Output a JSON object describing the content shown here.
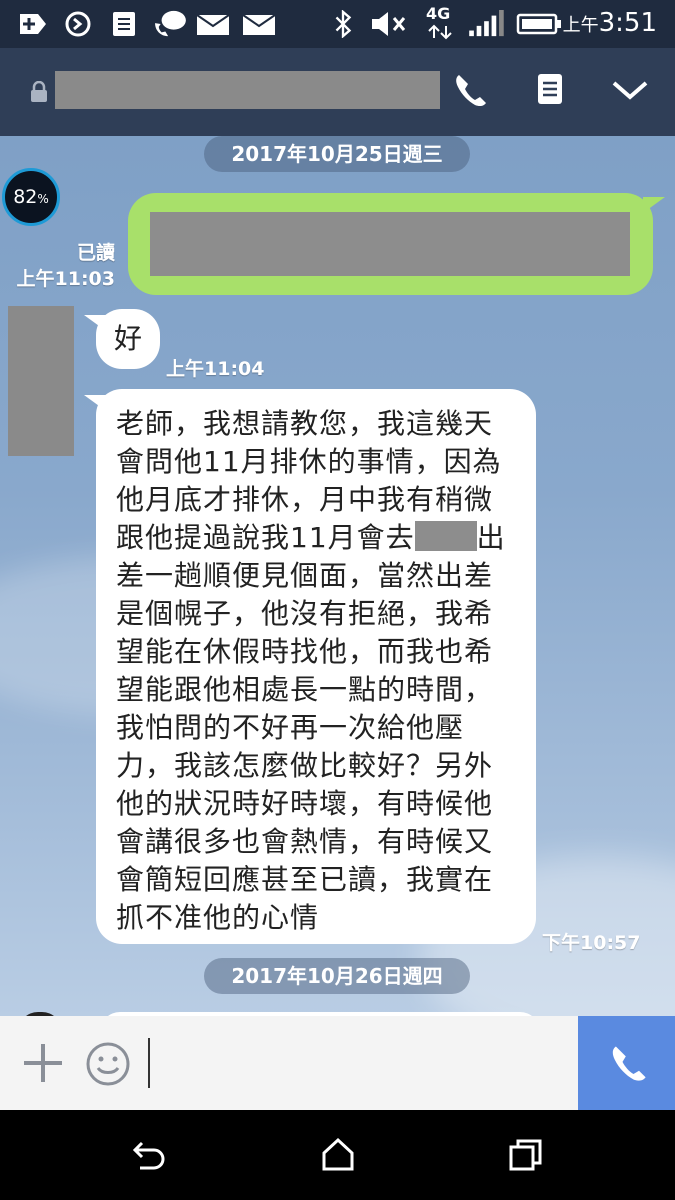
{
  "status_bar": {
    "time_period": "上午",
    "time": "3:51",
    "network": "4G",
    "icons": [
      "plus-box-icon",
      "sync-icon",
      "document-icon",
      "chat-phone-icon",
      "mail-icon",
      "mail-icon",
      "bluetooth-icon",
      "mute-icon",
      "4g-icon",
      "signal-icon",
      "battery-icon"
    ]
  },
  "header": {
    "icons": [
      "lock-icon",
      "phone-icon",
      "notes-icon",
      "chevron-down-icon"
    ]
  },
  "chat": {
    "date1": "2017年10月25日週三",
    "date2": "2017年10月26日週四",
    "battery_widget": {
      "value": "82",
      "unit": "%"
    },
    "sent_msg": {
      "read_label": "已讀",
      "time": "上午11:03"
    },
    "recv_short": {
      "text": "好",
      "time": "上午11:04"
    },
    "recv_long": {
      "lines": [
        "老師，我想請教您，我這幾天",
        "會問他11月排休的事情，因為",
        "他月底才排休，月中我有稍微",
        "跟他提過說我11月會去",
        "出",
        "差一趟順便見個面，當然出差",
        "是個幌子，他沒有拒絕，我希",
        "望能在休假時找他，而我也希",
        "望能跟他相處長一點的時間，",
        "我怕問的不好再一次給他壓",
        "力，我該怎麼做比較好？另外",
        "他的狀況時好時壞，有時候他",
        "會講很多也會熱情，有時候又",
        "會簡短回應甚至已讀，我實在",
        "抓不准他的心情"
      ],
      "time": "下午10:57"
    }
  },
  "input_bar": {
    "icons": [
      "plus-icon",
      "emoji-icon",
      "phone-icon"
    ]
  },
  "nav_bar": {
    "icons": [
      "back-icon",
      "home-icon",
      "recents-icon"
    ]
  },
  "colors": {
    "status_bg": "#1f2b3f",
    "header_bg": "#2f3e57",
    "sent_bubble": "#a8e06a",
    "call_button": "#5a8ae0"
  }
}
